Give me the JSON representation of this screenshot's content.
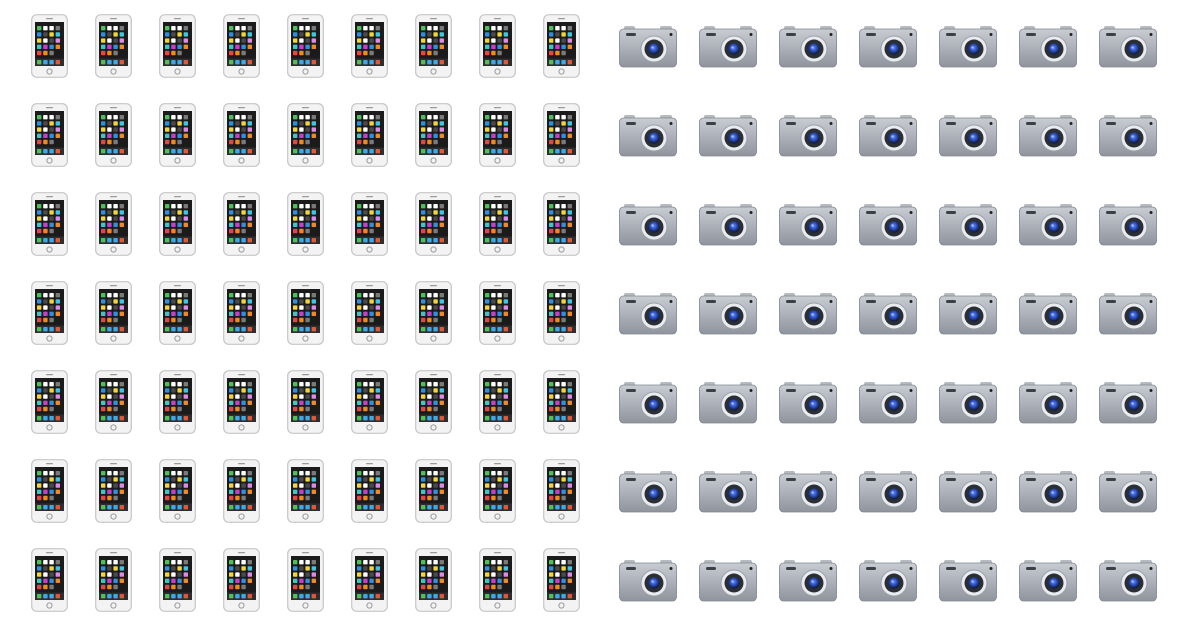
{
  "grids": [
    {
      "icon": "mobile-phone-icon",
      "rows": 7,
      "cols": 9
    },
    {
      "icon": "camera-icon",
      "rows": 7,
      "cols": 7
    }
  ],
  "colors": {
    "phone_body": "#f3f3f3",
    "phone_border": "#c6c6c6",
    "phone_screen": "#1b1b1b",
    "app_colors": [
      "#4cc05a",
      "#ffffff",
      "#ffffff",
      "#7a7a7a",
      "#2f8fe0",
      "#4a4a4a",
      "#f5d33a",
      "#3fc5e0",
      "#f5d33a",
      "#ffffff",
      "#4a4a4a",
      "#e08ae8",
      "#3fc5c5",
      "#c840c8",
      "#2f8fe0",
      "#f08a1a",
      "#e04848",
      "#f08a1a",
      "#7a7a7a"
    ],
    "dock_colors": [
      "#4cc05a",
      "#3fa8e8",
      "#3fa8e8",
      "#e05a3a"
    ],
    "camera_body_top": "#c9ccd3",
    "camera_body_bottom": "#8f949d",
    "lens": "#2a4fc0"
  }
}
